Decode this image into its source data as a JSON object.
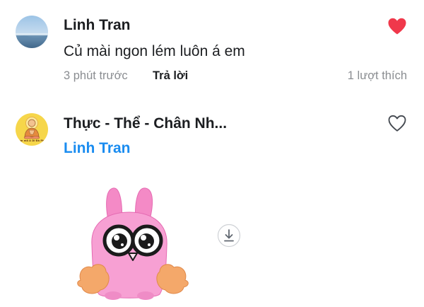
{
  "comments": [
    {
      "author": "Linh Tran",
      "text": "Củ mài ngon lém luôn á em",
      "time": "3 phút trước",
      "reply_label": "Trả lời",
      "likes": "1 lượt thích",
      "liked": true,
      "heart_icon": "heart-filled-icon",
      "heart_color": "#f0384b"
    },
    {
      "author": "Thực - Thể - Chân Nh...",
      "mention": "Linh Tran",
      "liked": false,
      "heart_icon": "heart-outline-icon",
      "sticker_icon": "pink-bunny-sticker",
      "download_icon": "download-icon",
      "avatar_caption": "Nam mô A Di Đà Phật"
    }
  ],
  "colors": {
    "mention": "#1a8cf0",
    "meta": "#8a8d91",
    "like_active": "#f0384b"
  }
}
